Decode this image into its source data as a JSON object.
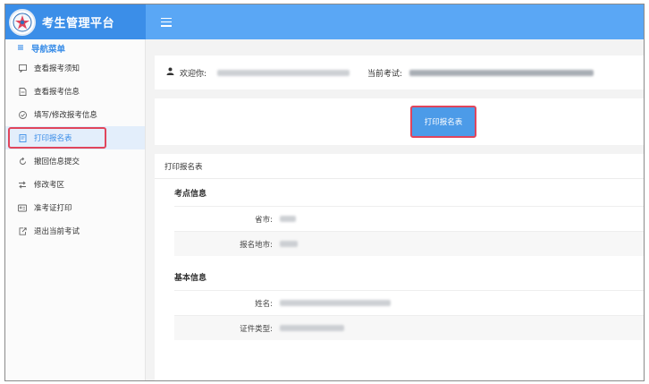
{
  "app": {
    "title": "考生管理平台",
    "logo_icon": "star-badge-icon",
    "brand_color": "#3b8ee8",
    "topbar_color": "#5aa7f5"
  },
  "sidebar": {
    "header": "导航菜单",
    "items": [
      {
        "label": "查看报考须知",
        "icon": "message-icon",
        "active": false
      },
      {
        "label": "查看报考信息",
        "icon": "document-icon",
        "active": false
      },
      {
        "label": "填写/修改报考信息",
        "icon": "check-circle-icon",
        "active": false
      },
      {
        "label": "打印报名表",
        "icon": "print-icon",
        "active": true
      },
      {
        "label": "撤回信息提交",
        "icon": "undo-icon",
        "active": false
      },
      {
        "label": "修改考区",
        "icon": "swap-icon",
        "active": false
      },
      {
        "label": "准考证打印",
        "icon": "id-card-icon",
        "active": false
      },
      {
        "label": "退出当前考试",
        "icon": "exit-icon",
        "active": false
      }
    ]
  },
  "welcome": {
    "greeting": "欢迎你:",
    "exam_label": "当前考试:"
  },
  "main": {
    "print_button": "打印报名表",
    "card_title": "打印报名表",
    "sections": [
      {
        "title": "考点信息",
        "fields": [
          {
            "label": "省市:"
          },
          {
            "label": "报名地市:"
          }
        ]
      },
      {
        "title": "基本信息",
        "fields": [
          {
            "label": "姓名:"
          },
          {
            "label": "证件类型:"
          }
        ]
      }
    ]
  }
}
